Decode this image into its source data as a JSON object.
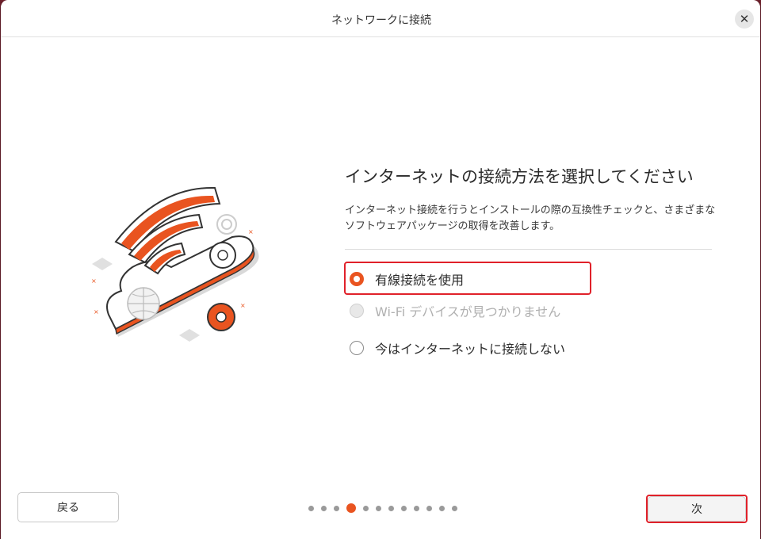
{
  "window": {
    "title": "ネットワークに接続",
    "close_symbol": "✕"
  },
  "main": {
    "heading": "インターネットの接続方法を選択してください",
    "description": "インターネット接続を行うとインストールの際の互換性チェックと、さまざまなソフトウェアパッケージの取得を改善します。",
    "options": [
      {
        "label": "有線接続を使用",
        "checked": true,
        "disabled": false
      },
      {
        "label": "Wi-Fi デバイスが見つかりません",
        "checked": false,
        "disabled": true
      },
      {
        "label": "今はインターネットに接続しない",
        "checked": false,
        "disabled": false
      }
    ]
  },
  "footer": {
    "back_label": "戻る",
    "next_label": "次",
    "pagination": {
      "total_steps": 12,
      "current_step": 4
    }
  },
  "colors": {
    "accent": "#e95420",
    "highlight": "#e0212a"
  }
}
